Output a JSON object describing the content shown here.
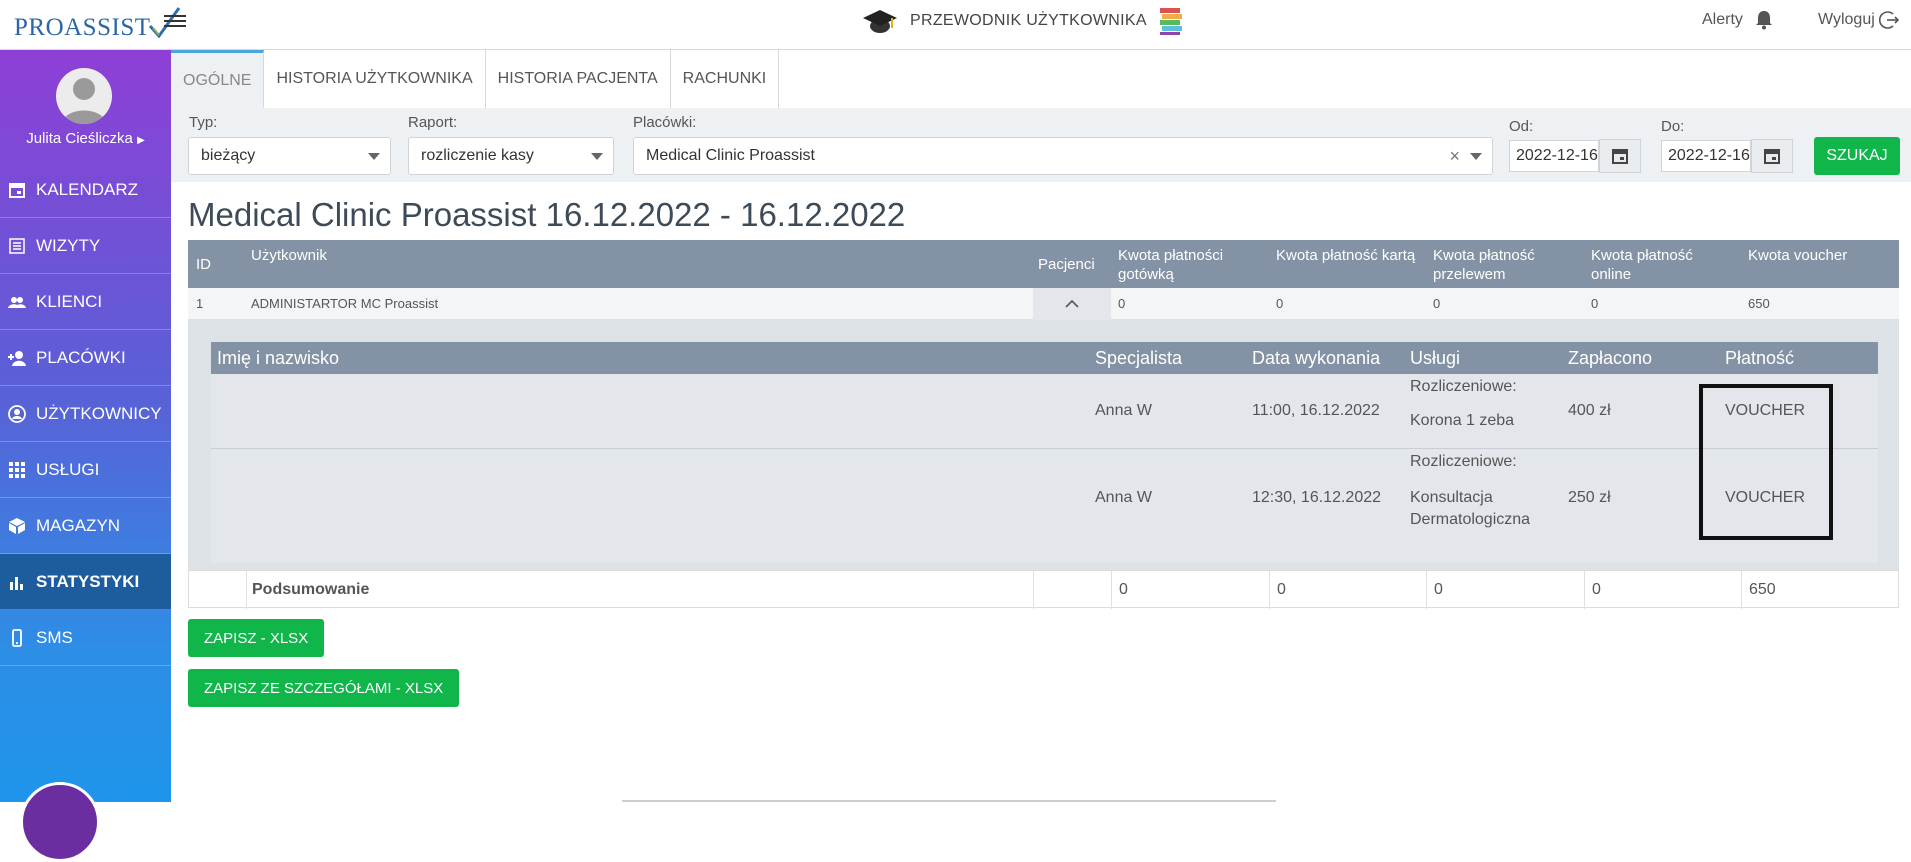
{
  "header": {
    "logo": "PROASSIST",
    "guide_label": "PRZEWODNIK UŻYTKOWNIKA",
    "alerts_label": "Alerty",
    "logout_label": "Wyloguj"
  },
  "sidebar": {
    "user_name": "Julita Cieśliczka",
    "items": [
      {
        "label": "KALENDARZ",
        "icon": "calendar-icon"
      },
      {
        "label": "WIZYTY",
        "icon": "list-icon"
      },
      {
        "label": "KLIENCI",
        "icon": "users-icon"
      },
      {
        "label": "PLACÓWKI",
        "icon": "add-user-icon"
      },
      {
        "label": "UŻYTKOWNICY",
        "icon": "user-circle-icon"
      },
      {
        "label": "USŁUGI",
        "icon": "grid-icon"
      },
      {
        "label": "MAGAZYN",
        "icon": "box-icon"
      },
      {
        "label": "STATYSTYKI",
        "icon": "bar-chart-icon",
        "active": true
      },
      {
        "label": "SMS",
        "icon": "phone-icon"
      }
    ]
  },
  "tabs": [
    {
      "label": "OGÓLNE",
      "active": true
    },
    {
      "label": "HISTORIA UŻYTKOWNIKA"
    },
    {
      "label": "HISTORIA PACJENTA"
    },
    {
      "label": "RACHUNKI"
    }
  ],
  "filters": {
    "type_label": "Typ:",
    "type_value": "bieżący",
    "report_label": "Raport:",
    "report_value": "rozliczenie kasy",
    "facility_label": "Placówki:",
    "facility_value": "Medical Clinic Proassist",
    "from_label": "Od:",
    "from_value": "2022-12-16",
    "to_label": "Do:",
    "to_value": "2022-12-16",
    "search_label": "SZUKAJ"
  },
  "report": {
    "title": "Medical Clinic Proassist 16.12.2022 - 16.12.2022",
    "columns": [
      "ID",
      "Użytkownik",
      "Pacjenci",
      "Kwota płatności gotówką",
      "Kwota płatność kartą",
      "Kwota płatność przelewem",
      "Kwota płatność online",
      "Kwota voucher"
    ],
    "row": {
      "id": "1",
      "user": "ADMINISTARTOR MC Proassist",
      "cash": "0",
      "card": "0",
      "transfer": "0",
      "online": "0",
      "voucher": "650"
    },
    "detail_columns": [
      "Imię i nazwisko",
      "Specjalista",
      "Data wykonania",
      "Usługi",
      "Zapłacono",
      "Płatność"
    ],
    "details": [
      {
        "name": "",
        "specialist": "Anna W",
        "date": "11:00, 16.12.2022",
        "service_group": "Rozliczeniowe:",
        "service": "Korona 1 zeba",
        "service2": "",
        "paid": "400 zł",
        "payment": "VOUCHER"
      },
      {
        "name": "",
        "specialist": "Anna W",
        "date": "12:30, 16.12.2022",
        "service_group": "Rozliczeniowe:",
        "service": "Konsultacja",
        "service2": "Dermatologiczna",
        "paid": "250 zł",
        "payment": "VOUCHER"
      }
    ],
    "summary": {
      "label": "Podsumowanie",
      "cash": "0",
      "card": "0",
      "transfer": "0",
      "online": "0",
      "voucher": "650"
    }
  },
  "actions": {
    "export_xlsx": "ZAPISZ - XLSX",
    "export_details_xlsx": "ZAPISZ ZE SZCZEGÓŁAMI - XLSX"
  },
  "colors": {
    "accent_green": "#10b64a",
    "table_header": "#8392a4",
    "active_nav": "#1d5d9e"
  }
}
